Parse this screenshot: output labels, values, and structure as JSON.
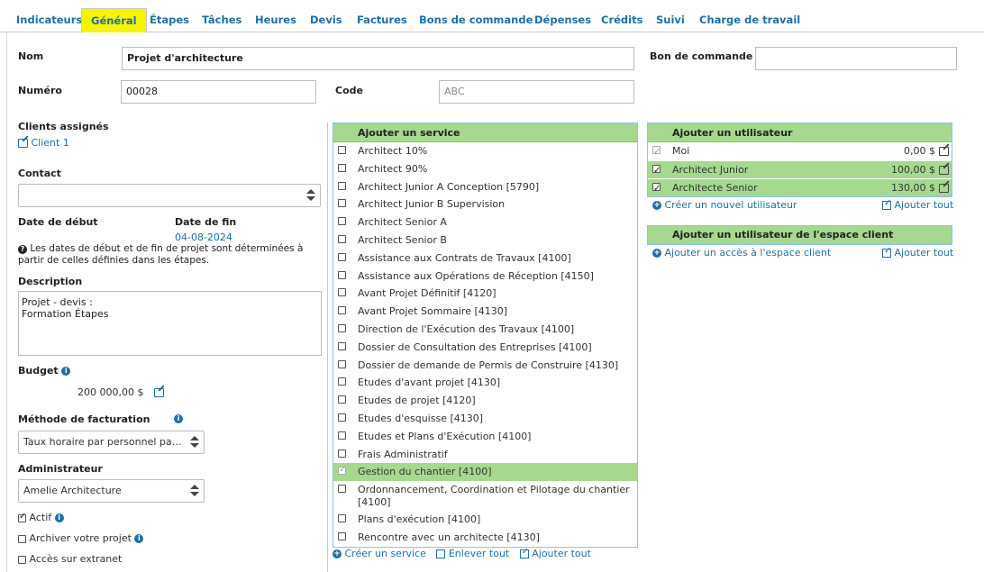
{
  "tabs": [
    {
      "label": "Indicateurs"
    },
    {
      "label": "Général"
    },
    {
      "label": "Étapes"
    },
    {
      "label": "Tâches"
    },
    {
      "label": "Heures"
    },
    {
      "label": "Devis"
    },
    {
      "label": "Factures"
    },
    {
      "label": "Bons de commande"
    },
    {
      "label": "Dépenses"
    },
    {
      "label": "Crédits"
    },
    {
      "label": "Suivi"
    },
    {
      "label": "Charge de travail"
    }
  ],
  "active_tab": "Général",
  "form": {
    "nom_label": "Nom",
    "nom_value": "Projet d'architecture",
    "bon_label": "Bon de commande",
    "bon_value": "",
    "numero_label": "Numéro",
    "numero_value": "00028",
    "code_label": "Code",
    "code_placeholder": "ABC",
    "clients_label": "Clients assignés",
    "client_link": "Client 1",
    "contact_label": "Contact",
    "contact_value": "",
    "date_debut_label": "Date de début",
    "date_fin_label": "Date de fin",
    "date_fin_value": "04-08-2024",
    "dates_note": "Les dates de début et de fin de projet sont déterminées à partir de celles définies dans les étapes.",
    "description_label": "Description",
    "description_value": "Projet - devis :\nFormation Étapes",
    "budget_label": "Budget",
    "budget_value": "200 000,00 $",
    "methode_label": "Méthode de facturation",
    "methode_value": "Taux horaire par personnel par projet",
    "admin_label": "Administrateur",
    "admin_value": "Amelie Architecture",
    "actif_label": "Actif",
    "actif_checked": true,
    "archiver_label": "Archiver votre projet",
    "archiver_checked": false,
    "extranet_label": "Accès sur extranet",
    "extranet_checked": false
  },
  "services": {
    "title": "Ajouter un service",
    "items": [
      {
        "label": "Architect 10%",
        "checked": false
      },
      {
        "label": "Architect 90%",
        "checked": false
      },
      {
        "label": "Architect Junior A Conception [5790]",
        "checked": false
      },
      {
        "label": "Architect Junior B Supervision",
        "checked": false
      },
      {
        "label": "Architect Senior A",
        "checked": false
      },
      {
        "label": "Architect Senior B",
        "checked": false
      },
      {
        "label": "Assistance aux Contrats de Travaux [4100]",
        "checked": false
      },
      {
        "label": "Assistance aux Opérations de Réception [4150]",
        "checked": false
      },
      {
        "label": "Avant Projet Définitif [4120]",
        "checked": false
      },
      {
        "label": "Avant Projet Sommaire [4130]",
        "checked": false
      },
      {
        "label": "Direction de l'Exécution des Travaux [4100]",
        "checked": false
      },
      {
        "label": "Dossier de Consultation des Entreprises [4100]",
        "checked": false
      },
      {
        "label": "Dossier de demande de Permis de Construire [4130]",
        "checked": false
      },
      {
        "label": "Etudes d'avant projet [4130]",
        "checked": false
      },
      {
        "label": "Etudes de projet [4120]",
        "checked": false
      },
      {
        "label": "Etudes d'esquisse [4130]",
        "checked": false
      },
      {
        "label": "Etudes et Plans d'Exécution [4100]",
        "checked": false
      },
      {
        "label": "Frais Administratif",
        "checked": false
      },
      {
        "label": "Gestion du chantier [4100]",
        "checked": true
      },
      {
        "label": "Ordonnancement, Coordination et Pilotage du chantier [4100]",
        "checked": false
      },
      {
        "label": "Plans d'exécution [4100]",
        "checked": false
      },
      {
        "label": "Rencontre avec un architecte [4130]",
        "checked": false
      }
    ],
    "create_link": "Créer un service",
    "remove_all": "Enlever tout",
    "add_all": "Ajouter tout"
  },
  "users": {
    "title": "Ajouter un utilisateur",
    "items": [
      {
        "name": "Moi",
        "amount": "0,00 $",
        "checked": true
      },
      {
        "name": "Architect Junior",
        "amount": "100,00 $",
        "checked": true
      },
      {
        "name": "Architecte Senior",
        "amount": "130,00 $",
        "checked": true
      }
    ],
    "create_link": "Créer un nouvel utilisateur",
    "add_all": "Ajouter tout"
  },
  "client_space": {
    "title": "Ajouter un utilisateur de l'espace client",
    "add_link": "Ajouter un accès à l'espace client",
    "add_all": "Ajouter tout"
  },
  "colors": {
    "accent": "#1f6fa8",
    "highlight_tab": "#f5f500",
    "green_header": "#a6d88f"
  }
}
